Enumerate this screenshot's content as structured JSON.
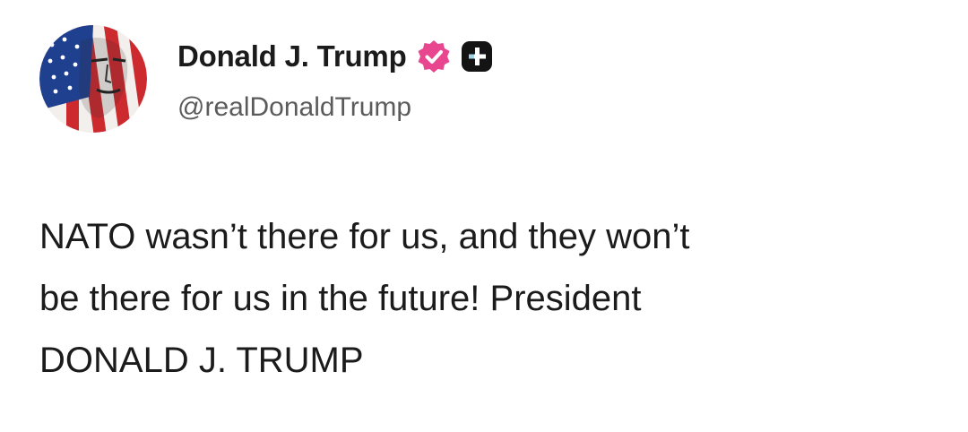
{
  "author": {
    "display_name": "Donald J. Trump",
    "handle": "@realDonaldTrump",
    "avatar_icon": "portrait-flag-avatar",
    "verified_icon": "verified-badge-icon",
    "extra_badge_icon": "plus-badge-icon",
    "verified_color": "#e8468f",
    "extra_badge_color": "#141414"
  },
  "post": {
    "lines": [
      "NATO wasn’t there for us, and they won’t",
      "be there for us in the future! President",
      "DONALD J. TRUMP"
    ]
  }
}
